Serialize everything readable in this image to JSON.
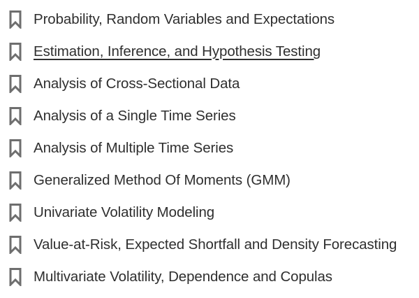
{
  "colors": {
    "icon": "#6e6e6e",
    "text": "#2f2f2f",
    "background": "#ffffff"
  },
  "bookmarks": [
    {
      "label": "Probability, Random Variables and Expectations",
      "icon": "bookmark-icon",
      "active": false
    },
    {
      "label": "Estimation, Inference, and Hypothesis Testing",
      "icon": "bookmark-icon",
      "active": true
    },
    {
      "label": "Analysis of Cross-Sectional Data",
      "icon": "bookmark-icon",
      "active": false
    },
    {
      "label": "Analysis of a Single Time Series",
      "icon": "bookmark-icon",
      "active": false
    },
    {
      "label": "Analysis of Multiple Time Series",
      "icon": "bookmark-icon",
      "active": false
    },
    {
      "label": "Generalized Method Of Moments (GMM)",
      "icon": "bookmark-icon",
      "active": false
    },
    {
      "label": "Univariate Volatility Modeling",
      "icon": "bookmark-icon",
      "active": false
    },
    {
      "label": "Value-at-Risk, Expected Shortfall and Density Forecasting",
      "icon": "bookmark-icon",
      "active": false
    },
    {
      "label": "Multivariate Volatility, Dependence and Copulas",
      "icon": "bookmark-icon",
      "active": false
    }
  ]
}
